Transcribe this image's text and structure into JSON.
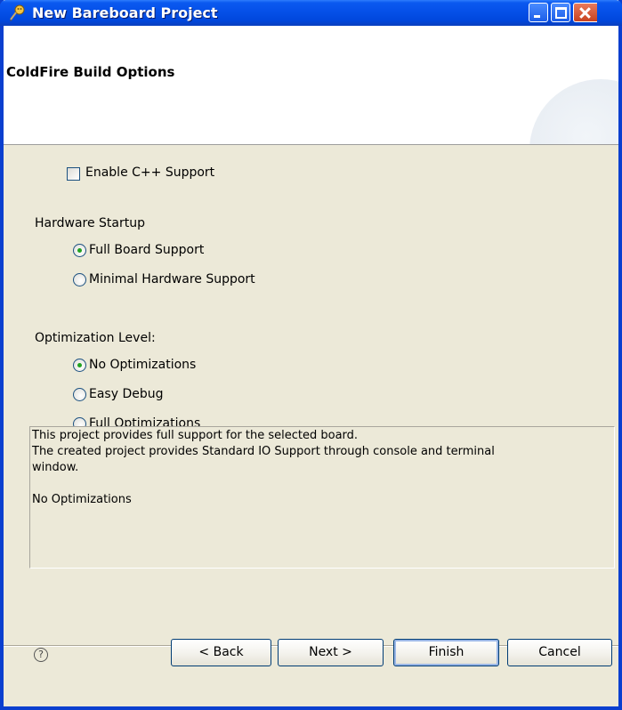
{
  "window": {
    "title": "New Bareboard Project"
  },
  "banner": {
    "title": "ColdFire Build Options"
  },
  "options": {
    "cpp_support": {
      "label": "Enable C++ Support",
      "checked": false
    },
    "hardware_startup": {
      "heading": "Hardware Startup",
      "choices": [
        {
          "label": "Full Board Support",
          "selected": true
        },
        {
          "label": "Minimal Hardware Support",
          "selected": false
        }
      ]
    },
    "optimization": {
      "heading": "Optimization Level:",
      "choices": [
        {
          "label": "No Optimizations",
          "selected": true
        },
        {
          "label": "Easy Debug",
          "selected": false
        },
        {
          "label": "Full Optimizations",
          "selected": false
        }
      ]
    }
  },
  "description": {
    "line1": "This project provides full support for the selected board.",
    "line2": "The created project provides Standard IO Support through console and terminal",
    "line3": "window.",
    "line4": "No Optimizations"
  },
  "buttons": {
    "help": "?",
    "back": "< Back",
    "next": "Next >",
    "finish": "Finish",
    "cancel": "Cancel"
  },
  "colors": {
    "titlebar": "#0550e8",
    "window_bg": "#ece9d8",
    "banner_bg": "#ffffff",
    "radio_dot": "#21a121"
  }
}
